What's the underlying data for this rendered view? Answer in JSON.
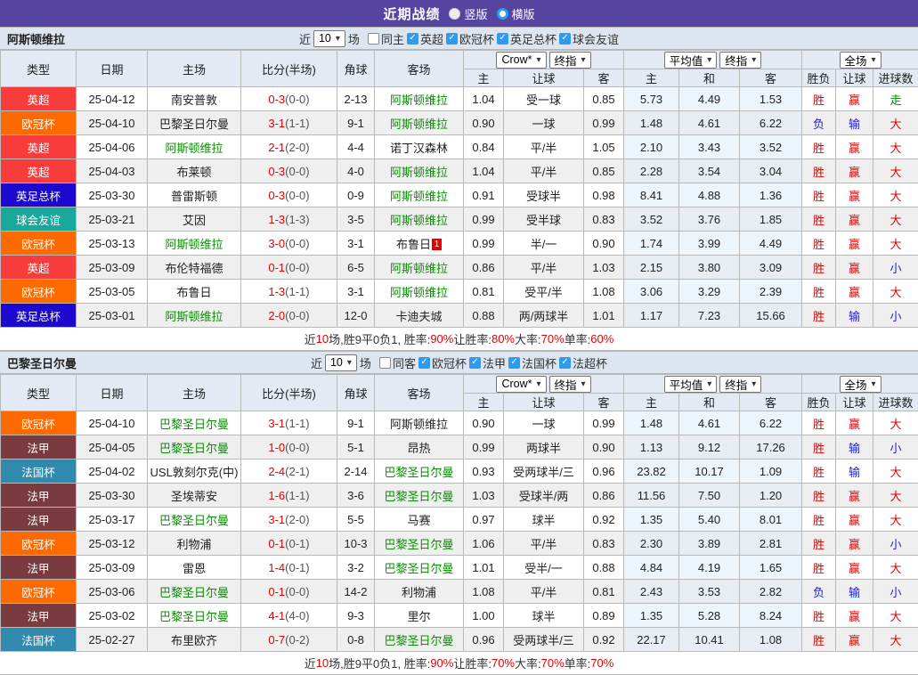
{
  "titlebar": {
    "title": "近期战绩",
    "radios": [
      {
        "label": "竖版",
        "checked": false
      },
      {
        "label": "横版",
        "checked": true
      }
    ]
  },
  "colors": {
    "titlebar_bg": "#5645a0",
    "accent_checkbox": "#2e9bef",
    "score_red": "#e60000",
    "focus_team_green": "#089000"
  },
  "competition_colors": {
    "英超": "#f83c3c",
    "欧冠杯": "#ff6a00",
    "英足总杯": "#1c08cf",
    "球会友谊": "#1ba89c",
    "法甲": "#7a3b40",
    "法国杯": "#3289ae"
  },
  "result_colors": {
    "胜": "#e60000",
    "负": "#2222cc",
    "赢": "#e60000",
    "输": "#2222cc",
    "大": "#e60000",
    "小": "#2222cc",
    "走": "#008800"
  },
  "table_headers": {
    "type": "类型",
    "date": "日期",
    "home": "主场",
    "score": "比分(半场)",
    "corner": "角球",
    "away": "客场",
    "group1_selects": [
      "Crow*",
      "终指"
    ],
    "group2_selects": [
      "平均值",
      "终指"
    ],
    "group3_selects": [
      "全场"
    ],
    "g1": [
      "主",
      "让球",
      "客"
    ],
    "g2": [
      "主",
      "和",
      "客"
    ],
    "g3": [
      "胜负",
      "让球",
      "进球数"
    ]
  },
  "sections": [
    {
      "team": "阿斯顿维拉",
      "filter": {
        "prefix": "近",
        "count": "10",
        "suffix": "场",
        "same_venue": {
          "label": "同主",
          "checked": false
        },
        "competitions": [
          {
            "label": "英超",
            "checked": true
          },
          {
            "label": "欧冠杯",
            "checked": true
          },
          {
            "label": "英足总杯",
            "checked": true
          },
          {
            "label": "球会友谊",
            "checked": true
          }
        ]
      },
      "rows": [
        {
          "type": "英超",
          "date": "25-04-12",
          "home": "南安普敦",
          "ft": "0-3",
          "ht": "(0-0)",
          "corner": "2-13",
          "away": "阿斯顿维拉",
          "o1": [
            "1.04",
            "受一球",
            "0.85"
          ],
          "o2": [
            "5.73",
            "4.49",
            "1.53"
          ],
          "res": [
            "胜",
            "赢",
            "走"
          ]
        },
        {
          "type": "欧冠杯",
          "date": "25-04-10",
          "home": "巴黎圣日尔曼",
          "ft": "3-1",
          "ht": "(1-1)",
          "corner": "9-1",
          "away": "阿斯顿维拉",
          "o1": [
            "0.90",
            "一球",
            "0.99"
          ],
          "o2": [
            "1.48",
            "4.61",
            "6.22"
          ],
          "res": [
            "负",
            "输",
            "大"
          ]
        },
        {
          "type": "英超",
          "date": "25-04-06",
          "home": "阿斯顿维拉",
          "ft": "2-1",
          "ht": "(2-0)",
          "corner": "4-4",
          "away": "诺丁汉森林",
          "o1": [
            "0.84",
            "平/半",
            "1.05"
          ],
          "o2": [
            "2.10",
            "3.43",
            "3.52"
          ],
          "res": [
            "胜",
            "赢",
            "大"
          ]
        },
        {
          "type": "英超",
          "date": "25-04-03",
          "home": "布莱顿",
          "ft": "0-3",
          "ht": "(0-0)",
          "corner": "4-0",
          "away": "阿斯顿维拉",
          "o1": [
            "1.04",
            "平/半",
            "0.85"
          ],
          "o2": [
            "2.28",
            "3.54",
            "3.04"
          ],
          "res": [
            "胜",
            "赢",
            "大"
          ]
        },
        {
          "type": "英足总杯",
          "date": "25-03-30",
          "home": "普雷斯顿",
          "ft": "0-3",
          "ht": "(0-0)",
          "corner": "0-9",
          "away": "阿斯顿维拉",
          "o1": [
            "0.91",
            "受球半",
            "0.98"
          ],
          "o2": [
            "8.41",
            "4.88",
            "1.36"
          ],
          "res": [
            "胜",
            "赢",
            "大"
          ]
        },
        {
          "type": "球会友谊",
          "date": "25-03-21",
          "home": "艾因",
          "ft": "1-3",
          "ht": "(1-3)",
          "corner": "3-5",
          "away": "阿斯顿维拉",
          "o1": [
            "0.99",
            "受半球",
            "0.83"
          ],
          "o2": [
            "3.52",
            "3.76",
            "1.85"
          ],
          "res": [
            "胜",
            "赢",
            "大"
          ]
        },
        {
          "type": "欧冠杯",
          "date": "25-03-13",
          "home": "阿斯顿维拉",
          "ft": "3-0",
          "ht": "(0-0)",
          "corner": "3-1",
          "away": "布鲁日",
          "away_redcard": "1",
          "o1": [
            "0.99",
            "半/一",
            "0.90"
          ],
          "o2": [
            "1.74",
            "3.99",
            "4.49"
          ],
          "res": [
            "胜",
            "赢",
            "大"
          ]
        },
        {
          "type": "英超",
          "date": "25-03-09",
          "home": "布伦特福德",
          "ft": "0-1",
          "ht": "(0-0)",
          "corner": "6-5",
          "away": "阿斯顿维拉",
          "o1": [
            "0.86",
            "平/半",
            "1.03"
          ],
          "o2": [
            "2.15",
            "3.80",
            "3.09"
          ],
          "res": [
            "胜",
            "赢",
            "小"
          ]
        },
        {
          "type": "欧冠杯",
          "date": "25-03-05",
          "home": "布鲁日",
          "ft": "1-3",
          "ht": "(1-1)",
          "corner": "3-1",
          "away": "阿斯顿维拉",
          "o1": [
            "0.81",
            "受平/半",
            "1.08"
          ],
          "o2": [
            "3.06",
            "3.29",
            "2.39"
          ],
          "res": [
            "胜",
            "赢",
            "大"
          ]
        },
        {
          "type": "英足总杯",
          "date": "25-03-01",
          "home": "阿斯顿维拉",
          "ft": "2-0",
          "ht": "(0-0)",
          "corner": "12-0",
          "away": "卡迪夫城",
          "o1": [
            "0.88",
            "两/两球半",
            "1.01"
          ],
          "o2": [
            "1.17",
            "7.23",
            "15.66"
          ],
          "res": [
            "胜",
            "输",
            "小"
          ]
        }
      ],
      "summary": [
        {
          "text": "近",
          "red": false
        },
        {
          "text": "10",
          "red": true
        },
        {
          "text": "场,胜9平0负1, 胜率:",
          "red": false
        },
        {
          "text": "90%",
          "red": true
        },
        {
          "text": " 让胜率:",
          "red": false
        },
        {
          "text": "80%",
          "red": true
        },
        {
          "text": " 大率:",
          "red": false
        },
        {
          "text": "70%",
          "red": true
        },
        {
          "text": " 单率:",
          "red": false
        },
        {
          "text": "60%",
          "red": true
        }
      ]
    },
    {
      "team": "巴黎圣日尔曼",
      "filter": {
        "prefix": "近",
        "count": "10",
        "suffix": "场",
        "same_venue": {
          "label": "同客",
          "checked": false
        },
        "competitions": [
          {
            "label": "欧冠杯",
            "checked": true
          },
          {
            "label": "法甲",
            "checked": true
          },
          {
            "label": "法国杯",
            "checked": true
          },
          {
            "label": "法超杯",
            "checked": true
          }
        ]
      },
      "rows": [
        {
          "type": "欧冠杯",
          "date": "25-04-10",
          "home": "巴黎圣日尔曼",
          "ft": "3-1",
          "ht": "(1-1)",
          "corner": "9-1",
          "away": "阿斯顿维拉",
          "o1": [
            "0.90",
            "一球",
            "0.99"
          ],
          "o2": [
            "1.48",
            "4.61",
            "6.22"
          ],
          "res": [
            "胜",
            "赢",
            "大"
          ]
        },
        {
          "type": "法甲",
          "date": "25-04-05",
          "home": "巴黎圣日尔曼",
          "ft": "1-0",
          "ht": "(0-0)",
          "corner": "5-1",
          "away": "昂热",
          "o1": [
            "0.99",
            "两球半",
            "0.90"
          ],
          "o2": [
            "1.13",
            "9.12",
            "17.26"
          ],
          "res": [
            "胜",
            "输",
            "小"
          ]
        },
        {
          "type": "法国杯",
          "date": "25-04-02",
          "home": "USL敦刻尔克(中)",
          "ft": "2-4",
          "ht": "(2-1)",
          "corner": "2-14",
          "away": "巴黎圣日尔曼",
          "o1": [
            "0.93",
            "受两球半/三",
            "0.96"
          ],
          "o2": [
            "23.82",
            "10.17",
            "1.09"
          ],
          "res": [
            "胜",
            "输",
            "大"
          ]
        },
        {
          "type": "法甲",
          "date": "25-03-30",
          "home": "圣埃蒂安",
          "ft": "1-6",
          "ht": "(1-1)",
          "corner": "3-6",
          "away": "巴黎圣日尔曼",
          "o1": [
            "1.03",
            "受球半/两",
            "0.86"
          ],
          "o2": [
            "11.56",
            "7.50",
            "1.20"
          ],
          "res": [
            "胜",
            "赢",
            "大"
          ]
        },
        {
          "type": "法甲",
          "date": "25-03-17",
          "home": "巴黎圣日尔曼",
          "ft": "3-1",
          "ht": "(2-0)",
          "corner": "5-5",
          "away": "马赛",
          "o1": [
            "0.97",
            "球半",
            "0.92"
          ],
          "o2": [
            "1.35",
            "5.40",
            "8.01"
          ],
          "res": [
            "胜",
            "赢",
            "大"
          ]
        },
        {
          "type": "欧冠杯",
          "date": "25-03-12",
          "home": "利物浦",
          "ft": "0-1",
          "ht": "(0-1)",
          "corner": "10-3",
          "away": "巴黎圣日尔曼",
          "o1": [
            "1.06",
            "平/半",
            "0.83"
          ],
          "o2": [
            "2.30",
            "3.89",
            "2.81"
          ],
          "res": [
            "胜",
            "赢",
            "小"
          ]
        },
        {
          "type": "法甲",
          "date": "25-03-09",
          "home": "雷恩",
          "ft": "1-4",
          "ht": "(0-1)",
          "corner": "3-2",
          "away": "巴黎圣日尔曼",
          "o1": [
            "1.01",
            "受半/一",
            "0.88"
          ],
          "o2": [
            "4.84",
            "4.19",
            "1.65"
          ],
          "res": [
            "胜",
            "赢",
            "大"
          ]
        },
        {
          "type": "欧冠杯",
          "date": "25-03-06",
          "home": "巴黎圣日尔曼",
          "ft": "0-1",
          "ht": "(0-0)",
          "corner": "14-2",
          "away": "利物浦",
          "o1": [
            "1.08",
            "平/半",
            "0.81"
          ],
          "o2": [
            "2.43",
            "3.53",
            "2.82"
          ],
          "res": [
            "负",
            "输",
            "小"
          ]
        },
        {
          "type": "法甲",
          "date": "25-03-02",
          "home": "巴黎圣日尔曼",
          "ft": "4-1",
          "ht": "(4-0)",
          "corner": "9-3",
          "away": "里尔",
          "o1": [
            "1.00",
            "球半",
            "0.89"
          ],
          "o2": [
            "1.35",
            "5.28",
            "8.24"
          ],
          "res": [
            "胜",
            "赢",
            "大"
          ]
        },
        {
          "type": "法国杯",
          "date": "25-02-27",
          "home": "布里欧齐",
          "ft": "0-7",
          "ht": "(0-2)",
          "corner": "0-8",
          "away": "巴黎圣日尔曼",
          "o1": [
            "0.96",
            "受两球半/三",
            "0.92"
          ],
          "o2": [
            "22.17",
            "10.41",
            "1.08"
          ],
          "res": [
            "胜",
            "赢",
            "大"
          ]
        }
      ],
      "summary": [
        {
          "text": "近",
          "red": false
        },
        {
          "text": "10",
          "red": true
        },
        {
          "text": "场,胜9平0负1, 胜率:",
          "red": false
        },
        {
          "text": "90%",
          "red": true
        },
        {
          "text": " 让胜率:",
          "red": false
        },
        {
          "text": "70%",
          "red": true
        },
        {
          "text": " 大率:",
          "red": false
        },
        {
          "text": "70%",
          "red": true
        },
        {
          "text": " 单率:",
          "red": false
        },
        {
          "text": "70%",
          "red": true
        }
      ]
    }
  ]
}
